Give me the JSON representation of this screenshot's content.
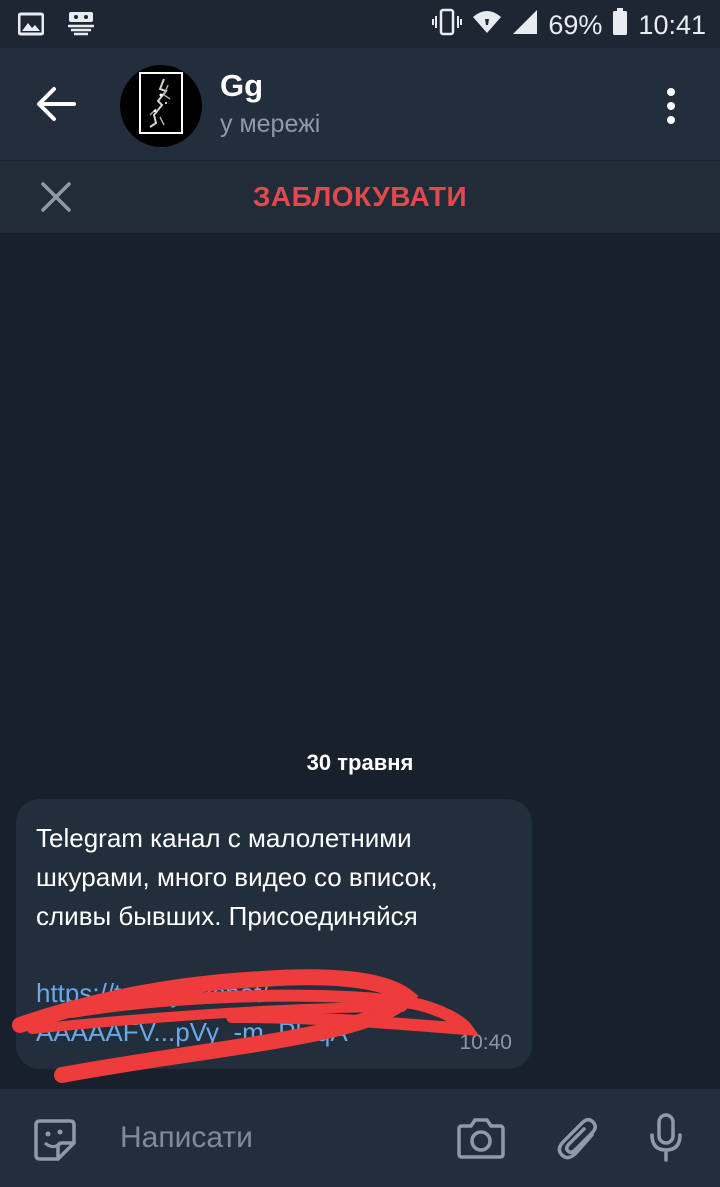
{
  "status_bar": {
    "battery": "69%",
    "time": "10:41",
    "icons": [
      "gallery-icon",
      "cast-icon",
      "vibrate-icon",
      "wifi-icon",
      "signal-icon",
      "battery-icon"
    ]
  },
  "header": {
    "back_icon": "arrow-left-icon",
    "title": "Gg",
    "status": "у мережі",
    "menu_icon": "more-vertical-icon"
  },
  "action_bar": {
    "close_icon": "close-icon",
    "block_label": "ЗАБЛОКУВАТИ",
    "block_color": "#e0494d"
  },
  "chat": {
    "date": "30 травня",
    "message": {
      "text": "Telegram канал с малолетними шкурами, много видео со вписок, сливы бывших. Присоединяйся",
      "link_line1": "https://t.me/joinchat/",
      "link_line2": "AAAAAFV...pVy_-m_PlaqA",
      "time": "10:40",
      "link_color": "#6aa9e9",
      "redaction_color": "#ee3b3b"
    }
  },
  "composer": {
    "placeholder": "Написати",
    "icons": [
      "sticker-icon",
      "camera-icon",
      "attach-icon",
      "microphone-icon"
    ]
  },
  "colors": {
    "background": "#18202b",
    "header": "#232e3c",
    "bubble": "#222e3b"
  }
}
